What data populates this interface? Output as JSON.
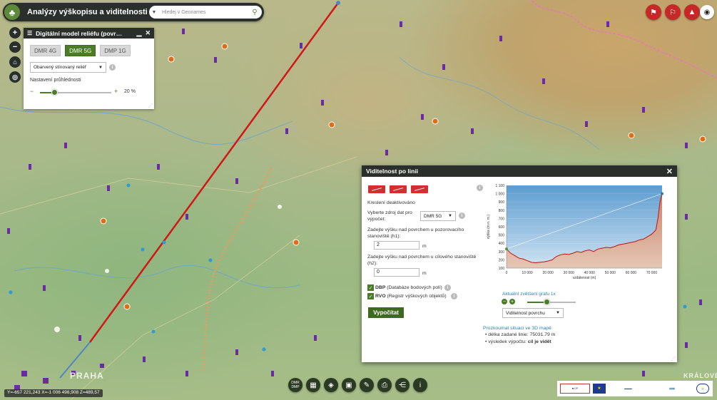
{
  "app": {
    "title": "Analýzy výškopisu a viditelnosti",
    "search_placeholder": "Hledej v Geonames"
  },
  "map_labels": {
    "city_prague": "PRAHA",
    "city_kralove": "KRÁLOVÉ"
  },
  "icons": {
    "logo": "tree-logo-icon",
    "search": "search-icon",
    "top_right": [
      "pin-point-icon",
      "pin-line-icon",
      "profile-chart-icon"
    ],
    "eye": "eye-icon"
  },
  "dmr_panel": {
    "title": "Digitální model reliéfu (povr…",
    "tabs": [
      {
        "label": "DMR 4G",
        "active": false
      },
      {
        "label": "DMR 5G",
        "active": true
      },
      {
        "label": "DMP 1G",
        "active": false
      }
    ],
    "render_mode": "Obarvený stínovaný reliéf",
    "transparency_label": "Nastavení průhlednosti",
    "transparency_value": "20 %",
    "transparency_fraction": 0.2
  },
  "visibility": {
    "title": "Viditelnost po linii",
    "drawing_status": "Kreslení deaktivováno",
    "source_label": "Vyberte zdroj dat pro výpočet:",
    "source_value": "DMR 5G",
    "h1_label": "Zadejte výšku nad povrchem u pozorovacího stanoviště (h1):",
    "h1_value": "2",
    "h1_unit": "m",
    "h2_label": "Zadejte výšku nad povrchem u cílového stanoviště (h2):",
    "h2_value": "0",
    "h2_unit": "m",
    "dbp_bold": "DBP",
    "dbp_text": "(Databáze bodových polí)",
    "rvo_bold": "RVO",
    "rvo_text": "(Registr výškových objektů)",
    "calc_button": "Vypočítat",
    "zoom_label": "Aktuální zvětšení grafu 1x",
    "zoom_fraction": 0.4,
    "mode_select": "Viditelnost povrchu",
    "link_3d": "Prozkoumat situaci ve 3D mapě",
    "result_length_label": "délka zadané linie:",
    "result_length_value": "75031.79 m",
    "result_label": "výsledek výpočtu:",
    "result_value": "cíl je vidět"
  },
  "chart_data": {
    "type": "area",
    "title": "",
    "xlabel": "vzdálenost (m)",
    "ylabel": "výška (m n. m.)",
    "xlim": [
      0,
      75000
    ],
    "ylim": [
      100,
      1100
    ],
    "xticks": [
      "0",
      "10 000",
      "20 000",
      "30 000",
      "40 000",
      "50 000",
      "60 000",
      "70 000"
    ],
    "yticks": [
      "100",
      "200",
      "300",
      "400",
      "500",
      "600",
      "700",
      "800",
      "900",
      "1 000",
      "1 100"
    ],
    "series": [
      {
        "x": [
          0,
          2000,
          4000,
          6000,
          8000,
          10000,
          12000,
          14000,
          16000,
          18000,
          20000,
          22000,
          24000,
          26000,
          28000,
          30000,
          32000,
          34000,
          36000,
          38000,
          40000,
          42000,
          44000,
          46000,
          48000,
          50000,
          52000,
          54000,
          56000,
          58000,
          60000,
          62000,
          64000,
          66000,
          68000,
          70000,
          72000,
          73000,
          74000,
          75000
        ],
        "y": [
          330,
          280,
          250,
          220,
          210,
          190,
          170,
          165,
          170,
          175,
          185,
          200,
          240,
          260,
          270,
          265,
          280,
          300,
          290,
          310,
          320,
          300,
          330,
          340,
          350,
          345,
          360,
          380,
          390,
          400,
          410,
          420,
          440,
          450,
          480,
          510,
          560,
          700,
          900,
          1000
        ]
      }
    ],
    "sight_line": {
      "from": [
        0,
        332
      ],
      "to": [
        75000,
        1000
      ]
    }
  },
  "bottom_tools": [
    "DMR DMP",
    "grid-icon",
    "layers-icon",
    "map-icon",
    "pencil-icon",
    "print-icon",
    "share-icon",
    "info-icon"
  ],
  "coords": "Y=-657 221,243  X=-1 006 498,908  Z=489,57"
}
